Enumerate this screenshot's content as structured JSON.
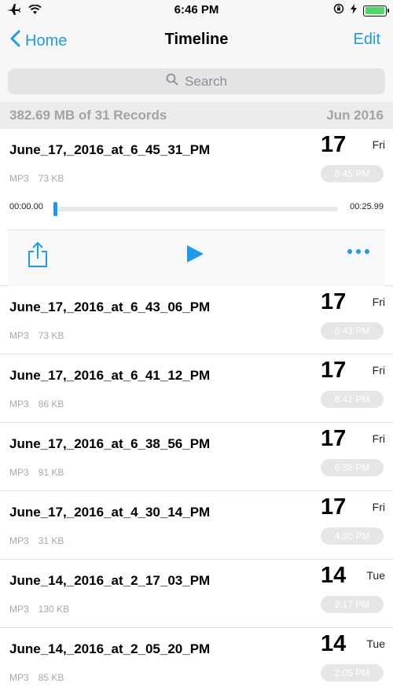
{
  "status": {
    "time": "6:46 PM"
  },
  "nav": {
    "back_label": "Home",
    "title": "Timeline",
    "edit_label": "Edit"
  },
  "search": {
    "placeholder": "Search"
  },
  "summary": {
    "left": "382.69 MB of 31 Records",
    "right": "Jun 2016"
  },
  "player": {
    "elapsed": "00:00.00",
    "duration": "00:25.99",
    "progress": 0
  },
  "records": [
    {
      "name": "June_17,_2016_at_6_45_31_PM",
      "format": "MP3",
      "size": "73 KB",
      "day": "17",
      "weekday": "Fri",
      "time": "6:45 PM"
    },
    {
      "name": "June_17,_2016_at_6_43_06_PM",
      "format": "MP3",
      "size": "73 KB",
      "day": "17",
      "weekday": "Fri",
      "time": "6:43 PM"
    },
    {
      "name": "June_17,_2016_at_6_41_12_PM",
      "format": "MP3",
      "size": "86 KB",
      "day": "17",
      "weekday": "Fri",
      "time": "6:41 PM"
    },
    {
      "name": "June_17,_2016_at_6_38_56_PM",
      "format": "MP3",
      "size": "91 KB",
      "day": "17",
      "weekday": "Fri",
      "time": "6:38 PM"
    },
    {
      "name": "June_17,_2016_at_4_30_14_PM",
      "format": "MP3",
      "size": "31 KB",
      "day": "17",
      "weekday": "Fri",
      "time": "4:30 PM"
    },
    {
      "name": "June_14,_2016_at_2_17_03_PM",
      "format": "MP3",
      "size": "130 KB",
      "day": "14",
      "weekday": "Tue",
      "time": "2:17 PM"
    },
    {
      "name": "June_14,_2016_at_2_05_20_PM",
      "format": "MP3",
      "size": "85 KB",
      "day": "14",
      "weekday": "Tue",
      "time": "2:05 PM"
    }
  ],
  "icons": {
    "airplane": "airplane-icon",
    "wifi": "wifi-icon",
    "orientation_lock": "orientation-lock-icon",
    "charging": "charging-bolt-icon",
    "battery": "battery-icon",
    "back": "chevron-left-icon",
    "search": "search-icon",
    "share": "share-icon",
    "play": "play-icon",
    "more": "more-icon"
  },
  "colors": {
    "accent": "#1a9bf0",
    "battery": "#4cd964",
    "muted": "#a3a3a3"
  }
}
